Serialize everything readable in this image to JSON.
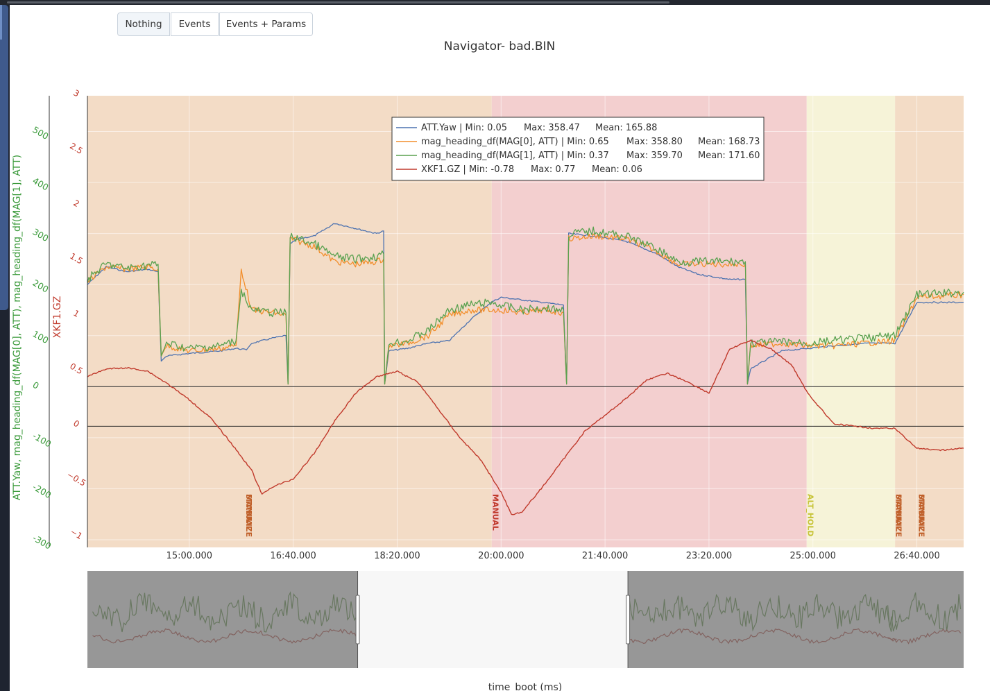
{
  "buttons": [
    {
      "label": "Nothing",
      "active": true
    },
    {
      "label": "Events",
      "active": false
    },
    {
      "label": "Events + Params",
      "active": false
    }
  ],
  "chart_data": {
    "type": "line",
    "title": "Navigator- bad.BIN",
    "xlabel": "time_boot (ms)",
    "x_ticks": [
      "15:00.000",
      "16:40.000",
      "18:20.000",
      "20:00.000",
      "21:40.000",
      "23:20.000",
      "25:00.000",
      "26:40.000"
    ],
    "x_range": [
      "13:22",
      "27:25"
    ],
    "y1": {
      "label": "ATT.Yaw, mag_heading_df(MAG[0], ATT), mag_heading_df(MAG[1], ATT)",
      "ticks": [
        500,
        400,
        300,
        200,
        100,
        0,
        -100,
        -200,
        -300
      ],
      "range": [
        -315,
        570
      ],
      "color": "#3a9a3a"
    },
    "y2": {
      "label": "XKF1.GZ",
      "ticks": [
        "3",
        "2.5",
        "2",
        "1.5",
        "1",
        "0.5",
        "0",
        "−0.5",
        "−1"
      ],
      "range": [
        -1.1,
        3.0
      ],
      "color": "#c0392b"
    },
    "legend": {
      "position": "top-center",
      "entries": [
        {
          "name": "ATT.Yaw",
          "min": "0.05",
          "max": "358.47",
          "mean": "165.88",
          "color": "#4c72b0"
        },
        {
          "name": "mag_heading_df(MAG[0], ATT)",
          "min": "0.65",
          "max": "358.80",
          "mean": "168.73",
          "color": "#f28e2b"
        },
        {
          "name": "mag_heading_df(MAG[1], ATT)",
          "min": "0.37",
          "max": "359.70",
          "mean": "171.60",
          "color": "#59a14f"
        },
        {
          "name": "XKF1.GZ",
          "min": "-0.78",
          "max": "0.77",
          "mean": "0.06",
          "color": "#c0392b"
        }
      ],
      "min_label": "Min:",
      "max_label": "Max:",
      "mean_label": "Mean:"
    },
    "modes": [
      {
        "name": "STABILIZE",
        "start": "13:22",
        "end": "19:51",
        "color": "#f3dcc6"
      },
      {
        "name": "MANUAL",
        "start": "19:51",
        "end": "24:54",
        "color": "#f3cfcf"
      },
      {
        "name": "ALT_HOLD",
        "start": "24:54",
        "end": "26:19",
        "color": "#f6f3d8"
      },
      {
        "name": "STABILIZE",
        "start": "26:19",
        "end": "27:25",
        "color": "#f3dcc6"
      }
    ],
    "mode_labels": [
      {
        "text": "STABILIZE",
        "time": "15:55",
        "color": "#c0612b"
      },
      {
        "text": "MANUAL",
        "time": "15:55",
        "color": "#c0612b"
      },
      {
        "text": "MANUAL",
        "time": "19:52",
        "color": "#c0392b"
      },
      {
        "text": "ALT_HOLD",
        "time": "24:55",
        "color": "#c8c43a"
      },
      {
        "text": "STABILIZE",
        "time": "26:20",
        "color": "#c0612b"
      },
      {
        "text": "MANUAL",
        "time": "26:20",
        "color": "#c0612b"
      },
      {
        "text": "STABILIZE",
        "time": "26:42",
        "color": "#c0612b"
      },
      {
        "text": "MANUAL",
        "time": "26:42",
        "color": "#c0612b"
      }
    ],
    "hlines": [
      {
        "axis": "y1",
        "value": 0
      },
      {
        "axis": "y2",
        "value": 0
      }
    ],
    "series": [
      {
        "name": "ATT.Yaw",
        "axis": "y1",
        "color": "#4c72b0",
        "points": [
          [
            "13:22",
            200
          ],
          [
            "13:40",
            235
          ],
          [
            "14:00",
            225
          ],
          [
            "14:20",
            230
          ],
          [
            "14:30",
            225
          ],
          [
            "14:33",
            50
          ],
          [
            "14:38",
            60
          ],
          [
            "15:00",
            65
          ],
          [
            "15:30",
            70
          ],
          [
            "15:45",
            75
          ],
          [
            "15:55",
            72
          ],
          [
            "16:00",
            85
          ],
          [
            "16:20",
            95
          ],
          [
            "16:33",
            100
          ],
          [
            "16:35",
            5
          ],
          [
            "16:37",
            280
          ],
          [
            "16:45",
            290
          ],
          [
            "17:00",
            295
          ],
          [
            "17:20",
            320
          ],
          [
            "17:40",
            310
          ],
          [
            "18:00",
            300
          ],
          [
            "18:07",
            305
          ],
          [
            "18:08",
            5
          ],
          [
            "18:12",
            70
          ],
          [
            "18:30",
            75
          ],
          [
            "18:50",
            85
          ],
          [
            "19:10",
            90
          ],
          [
            "19:30",
            130
          ],
          [
            "19:50",
            165
          ],
          [
            "20:00",
            175
          ],
          [
            "20:20",
            170
          ],
          [
            "20:40",
            165
          ],
          [
            "21:00",
            160
          ],
          [
            "21:03",
            5
          ],
          [
            "21:05",
            300
          ],
          [
            "21:30",
            295
          ],
          [
            "22:00",
            285
          ],
          [
            "22:30",
            260
          ],
          [
            "22:50",
            235
          ],
          [
            "23:10",
            220
          ],
          [
            "23:40",
            210
          ],
          [
            "23:55",
            210
          ],
          [
            "23:57",
            5
          ],
          [
            "24:00",
            35
          ],
          [
            "24:30",
            70
          ],
          [
            "24:55",
            75
          ],
          [
            "25:20",
            80
          ],
          [
            "25:50",
            85
          ],
          [
            "26:19",
            85
          ],
          [
            "26:40",
            165
          ],
          [
            "27:25",
            165
          ]
        ]
      },
      {
        "name": "mag_heading_df(MAG[0], ATT)",
        "axis": "y1",
        "color": "#f28e2b",
        "points": [
          [
            "13:22",
            205
          ],
          [
            "13:40",
            235
          ],
          [
            "14:00",
            230
          ],
          [
            "14:20",
            235
          ],
          [
            "14:30",
            230
          ],
          [
            "14:33",
            60
          ],
          [
            "14:38",
            80
          ],
          [
            "15:00",
            70
          ],
          [
            "15:30",
            75
          ],
          [
            "15:45",
            80
          ],
          [
            "15:50",
            230
          ],
          [
            "16:00",
            150
          ],
          [
            "16:20",
            145
          ],
          [
            "16:33",
            140
          ],
          [
            "16:35",
            5
          ],
          [
            "16:37",
            290
          ],
          [
            "17:00",
            275
          ],
          [
            "17:20",
            245
          ],
          [
            "17:40",
            240
          ],
          [
            "18:00",
            245
          ],
          [
            "18:07",
            250
          ],
          [
            "18:08",
            5
          ],
          [
            "18:12",
            80
          ],
          [
            "18:30",
            85
          ],
          [
            "18:50",
            100
          ],
          [
            "19:10",
            140
          ],
          [
            "19:30",
            150
          ],
          [
            "19:50",
            150
          ],
          [
            "20:00",
            150
          ],
          [
            "20:20",
            145
          ],
          [
            "20:40",
            150
          ],
          [
            "21:00",
            145
          ],
          [
            "21:03",
            5
          ],
          [
            "21:05",
            290
          ],
          [
            "21:30",
            295
          ],
          [
            "22:00",
            290
          ],
          [
            "22:30",
            265
          ],
          [
            "22:50",
            240
          ],
          [
            "23:10",
            240
          ],
          [
            "23:40",
            240
          ],
          [
            "23:55",
            240
          ],
          [
            "23:57",
            5
          ],
          [
            "24:00",
            80
          ],
          [
            "24:30",
            85
          ],
          [
            "24:55",
            80
          ],
          [
            "25:20",
            80
          ],
          [
            "25:50",
            85
          ],
          [
            "26:19",
            90
          ],
          [
            "26:40",
            175
          ],
          [
            "27:25",
            180
          ]
        ]
      },
      {
        "name": "mag_heading_df(MAG[1], ATT)",
        "axis": "y1",
        "color": "#59a14f",
        "points": [
          [
            "13:22",
            210
          ],
          [
            "13:40",
            240
          ],
          [
            "14:00",
            232
          ],
          [
            "14:20",
            238
          ],
          [
            "14:30",
            240
          ],
          [
            "14:33",
            60
          ],
          [
            "14:38",
            85
          ],
          [
            "15:00",
            75
          ],
          [
            "15:30",
            80
          ],
          [
            "15:45",
            90
          ],
          [
            "15:50",
            190
          ],
          [
            "16:00",
            150
          ],
          [
            "16:20",
            145
          ],
          [
            "16:33",
            145
          ],
          [
            "16:35",
            5
          ],
          [
            "16:37",
            295
          ],
          [
            "17:00",
            280
          ],
          [
            "17:20",
            255
          ],
          [
            "17:40",
            250
          ],
          [
            "18:00",
            255
          ],
          [
            "18:07",
            260
          ],
          [
            "18:08",
            5
          ],
          [
            "18:12",
            85
          ],
          [
            "18:30",
            90
          ],
          [
            "18:50",
            110
          ],
          [
            "19:10",
            150
          ],
          [
            "19:30",
            160
          ],
          [
            "19:50",
            165
          ],
          [
            "20:00",
            160
          ],
          [
            "20:20",
            150
          ],
          [
            "20:40",
            155
          ],
          [
            "21:00",
            150
          ],
          [
            "21:03",
            5
          ],
          [
            "21:05",
            300
          ],
          [
            "21:30",
            305
          ],
          [
            "22:00",
            295
          ],
          [
            "22:30",
            270
          ],
          [
            "22:50",
            245
          ],
          [
            "23:10",
            245
          ],
          [
            "23:40",
            245
          ],
          [
            "23:55",
            245
          ],
          [
            "23:57",
            5
          ],
          [
            "24:00",
            85
          ],
          [
            "24:30",
            88
          ],
          [
            "24:55",
            85
          ],
          [
            "25:20",
            90
          ],
          [
            "25:50",
            95
          ],
          [
            "26:19",
            100
          ],
          [
            "26:40",
            180
          ],
          [
            "27:25",
            185
          ]
        ]
      },
      {
        "name": "XKF1.GZ",
        "axis": "y2",
        "color": "#c0392b",
        "points": [
          [
            "13:22",
            0.45
          ],
          [
            "13:40",
            0.52
          ],
          [
            "14:00",
            0.53
          ],
          [
            "14:20",
            0.5
          ],
          [
            "14:40",
            0.38
          ],
          [
            "15:00",
            0.24
          ],
          [
            "15:20",
            0.08
          ],
          [
            "15:40",
            -0.15
          ],
          [
            "16:00",
            -0.4
          ],
          [
            "16:10",
            -0.62
          ],
          [
            "16:20",
            -0.55
          ],
          [
            "16:40",
            -0.48
          ],
          [
            "17:00",
            -0.25
          ],
          [
            "17:20",
            0.05
          ],
          [
            "17:40",
            0.3
          ],
          [
            "18:00",
            0.45
          ],
          [
            "18:20",
            0.5
          ],
          [
            "18:40",
            0.4
          ],
          [
            "19:00",
            0.15
          ],
          [
            "19:20",
            -0.1
          ],
          [
            "19:40",
            -0.3
          ],
          [
            "20:00",
            -0.6
          ],
          [
            "20:10",
            -0.8
          ],
          [
            "20:20",
            -0.78
          ],
          [
            "20:40",
            -0.55
          ],
          [
            "21:00",
            -0.3
          ],
          [
            "21:20",
            -0.05
          ],
          [
            "21:40",
            0.1
          ],
          [
            "22:00",
            0.25
          ],
          [
            "22:20",
            0.42
          ],
          [
            "22:40",
            0.48
          ],
          [
            "23:00",
            0.4
          ],
          [
            "23:20",
            0.3
          ],
          [
            "23:40",
            0.7
          ],
          [
            "24:00",
            0.78
          ],
          [
            "24:20",
            0.7
          ],
          [
            "24:40",
            0.55
          ],
          [
            "24:55",
            0.3
          ],
          [
            "25:20",
            0.02
          ],
          [
            "25:40",
            0.0
          ],
          [
            "26:00",
            -0.02
          ],
          [
            "26:19",
            -0.02
          ],
          [
            "26:40",
            -0.2
          ],
          [
            "27:00",
            -0.22
          ],
          [
            "27:25",
            -0.2
          ]
        ]
      }
    ]
  }
}
